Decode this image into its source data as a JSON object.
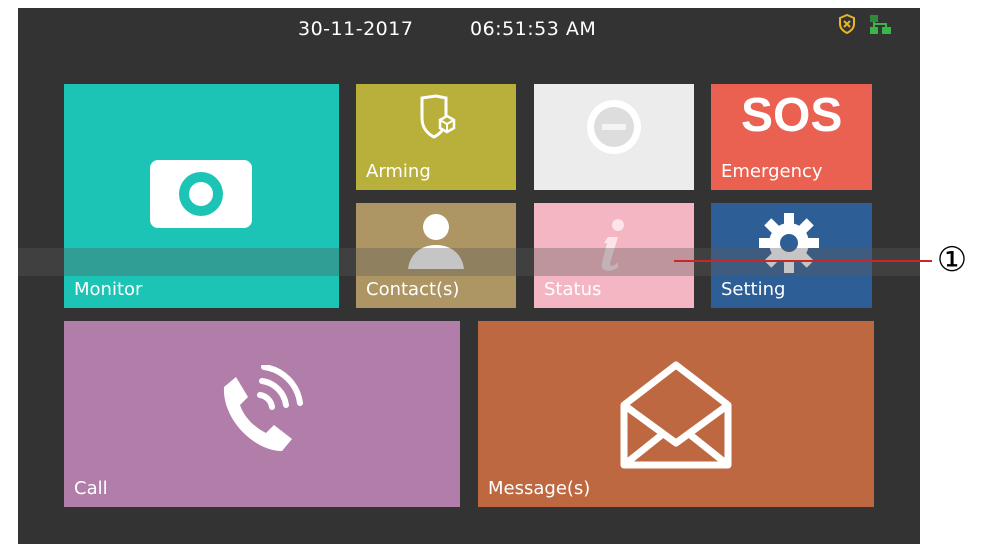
{
  "statusbar": {
    "date": "30-11-2017",
    "time": "06:51:53  AM",
    "icons": [
      "arming-shield-icon",
      "network-icon"
    ]
  },
  "tiles": {
    "monitor": {
      "label": "Monitor",
      "color": "#1bc4b5",
      "icon": "camera-icon"
    },
    "arming": {
      "label": "Arming",
      "color": "#b9b03c",
      "icon": "shield-icon"
    },
    "dnd": {
      "label": "",
      "color": "#ececec",
      "icon": "do-not-disturb-icon"
    },
    "emergency": {
      "label": "Emergency",
      "color": "#ea6051",
      "icon_text": "SOS"
    },
    "contacts": {
      "label": "Contact(s)",
      "color": "#ad9564",
      "icon": "person-icon"
    },
    "status": {
      "label": "Status",
      "color": "#f4b6c2",
      "icon": "info-icon"
    },
    "setting": {
      "label": "Setting",
      "color": "#2e5e96",
      "icon": "gear-icon"
    },
    "call": {
      "label": "Call",
      "color": "#b07ea8",
      "icon": "phone-icon"
    },
    "messages": {
      "label": "Message(s)",
      "color": "#bd6840",
      "icon": "envelope-icon"
    }
  },
  "callout": {
    "number": "①"
  }
}
